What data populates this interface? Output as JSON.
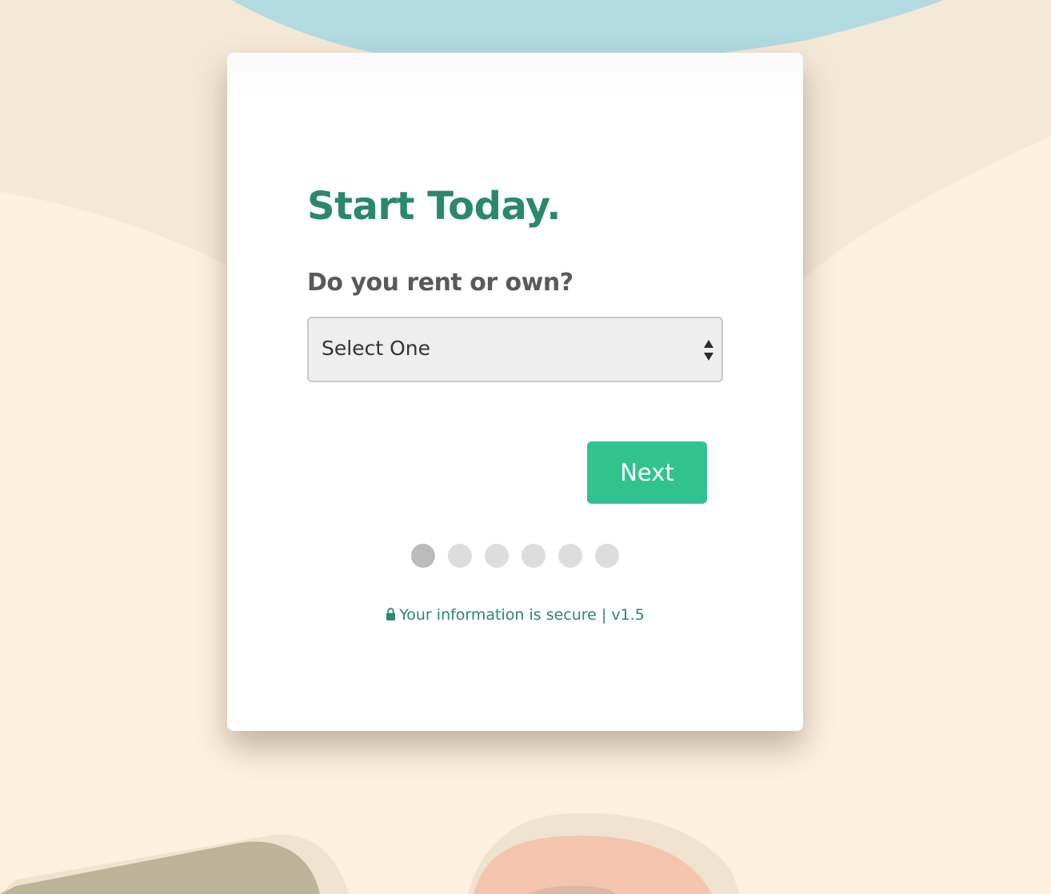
{
  "form": {
    "title": "Start Today.",
    "question": "Do you rent or own?",
    "select": {
      "selected_value": "Select One"
    },
    "next_label": "Next",
    "steps": {
      "total": 6,
      "current": 1
    },
    "secure_text": "Your information is secure | v1.5"
  },
  "colors": {
    "brand_green": "#2a8a68",
    "button_green": "#31c38f",
    "background": "#fdf0de"
  },
  "icons": {
    "lock": "lock-icon",
    "select_arrows": "sort-arrows-icon"
  }
}
